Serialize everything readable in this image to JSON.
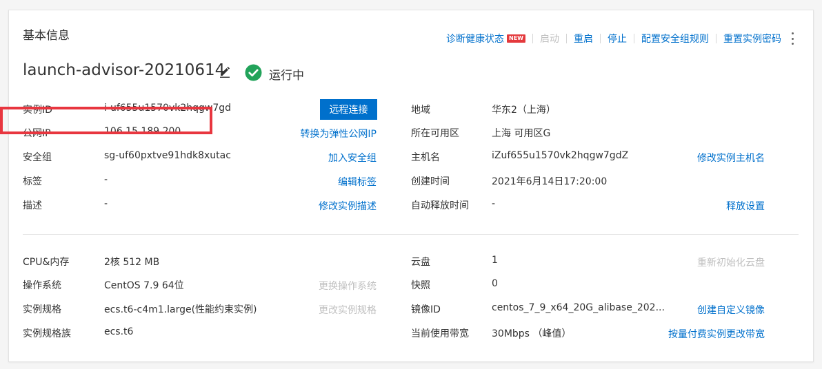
{
  "section_title": "基本信息",
  "toolbar": {
    "diagnose": "诊断健康状态",
    "new_badge": "NEW",
    "start": "启动",
    "restart": "重启",
    "stop": "停止",
    "config_sg": "配置安全组规则",
    "reset_password": "重置实例密码",
    "more_icon": "more-vertical-icon"
  },
  "instance": {
    "name": "launch-advisor-20210614",
    "status": "运行中",
    "status_color": "#22a35a",
    "edit_icon": "edit-icon"
  },
  "basic_left": {
    "instance_id": {
      "label": "实例ID",
      "value": "i-uf655u1570vk2hqgw7gd",
      "action": "远程连接"
    },
    "public_ip": {
      "label": "公网IP",
      "value": "106.15.189.200",
      "action": "转换为弹性公网IP"
    },
    "security_group": {
      "label": "安全组",
      "value": "sg-uf60pxtve91hdk8xutac",
      "action": "加入安全组"
    },
    "tags": {
      "label": "标签",
      "value": "-",
      "action": "编辑标签"
    },
    "description": {
      "label": "描述",
      "value": "-",
      "action": "修改实例描述"
    }
  },
  "basic_right": {
    "region": {
      "label": "地域",
      "value": "华东2（上海）"
    },
    "zone": {
      "label": "所在可用区",
      "value": "上海 可用区G"
    },
    "hostname": {
      "label": "主机名",
      "value": "iZuf655u1570vk2hqgw7gdZ",
      "action": "修改实例主机名"
    },
    "created": {
      "label": "创建时间",
      "value": "2021年6月14日17:20:00"
    },
    "auto_release": {
      "label": "自动释放时间",
      "value": "-",
      "action": "释放设置"
    }
  },
  "config_left": {
    "cpu_mem": {
      "label": "CPU&内存",
      "value": "2核 512 MB"
    },
    "os": {
      "label": "操作系统",
      "value": "CentOS 7.9 64位",
      "action": "更换操作系统"
    },
    "spec": {
      "label": "实例规格",
      "value": "ecs.t6-c4m1.large(性能约束实例)",
      "action": "更改实例规格"
    },
    "family": {
      "label": "实例规格族",
      "value": "ecs.t6"
    }
  },
  "config_right": {
    "disk": {
      "label": "云盘",
      "value": "1",
      "action": "重新初始化云盘"
    },
    "snapshot": {
      "label": "快照",
      "value": "0"
    },
    "image": {
      "label": "镜像ID",
      "value": "centos_7_9_x64_20G_alibase_202...",
      "action": "创建自定义镜像"
    },
    "bandwidth": {
      "label": "当前使用带宽",
      "value": "30Mbps （峰值）",
      "action": "按量付费实例更改带宽"
    }
  },
  "colors": {
    "link": "#0070cc",
    "primary_button": "#0070cc",
    "highlight_box": "#e8363f",
    "disabled": "#c0c0c0"
  }
}
